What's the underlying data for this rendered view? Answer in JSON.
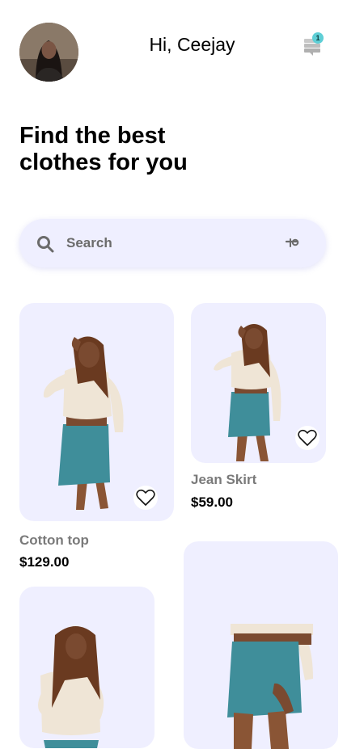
{
  "header": {
    "greeting": "Hi, Ceejay",
    "notification_count": "1"
  },
  "headline": {
    "line1": "Find the best",
    "line2": "clothes for you"
  },
  "search": {
    "placeholder": "Search"
  },
  "products": [
    {
      "name": "Cotton top",
      "price": "$129.00"
    },
    {
      "name": "Jean Skirt",
      "price": "$59.00"
    }
  ],
  "colors": {
    "card_bg": "#efefff",
    "badge": "#5fcfd6",
    "denim": "#3f8e9a",
    "top": "#efe5d6"
  },
  "icons": [
    "avatar",
    "notification-icon",
    "search-icon",
    "filter-icon",
    "heart-icon"
  ]
}
